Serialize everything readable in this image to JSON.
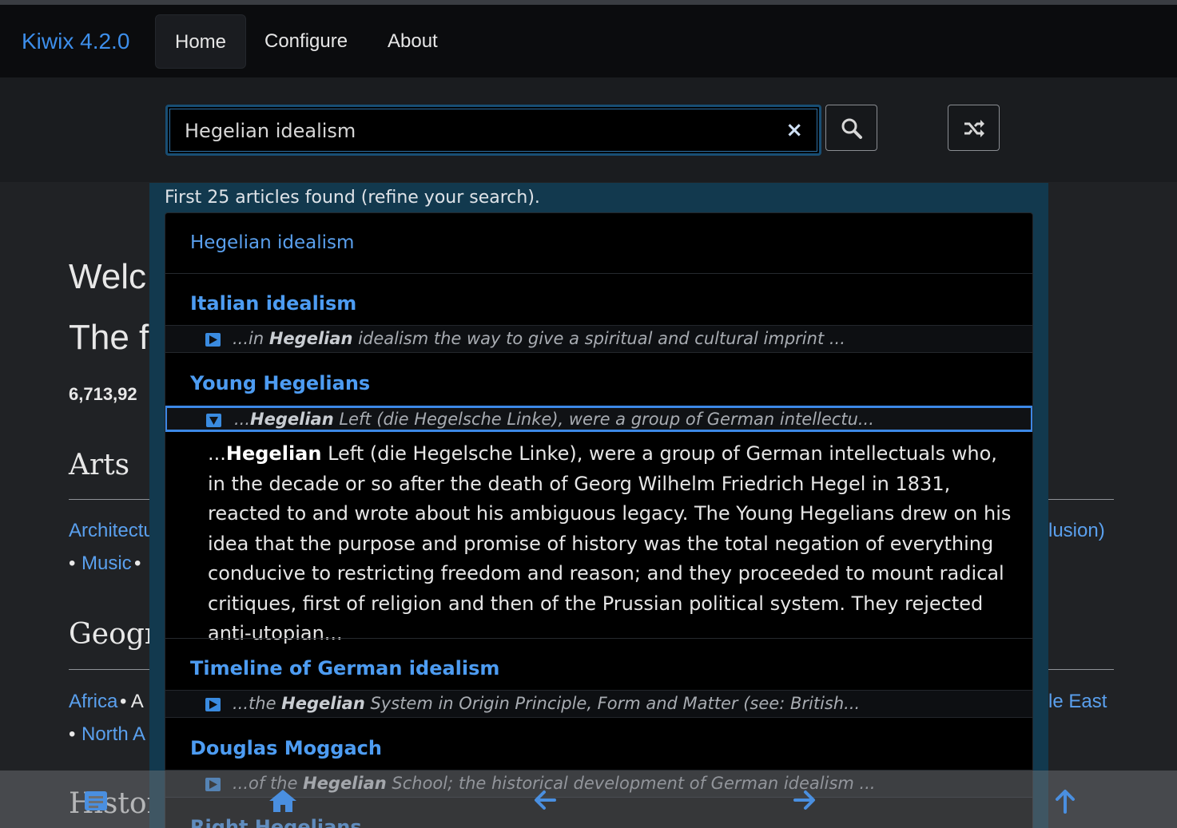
{
  "navbar": {
    "brand": "Kiwix 4.2.0",
    "items": [
      {
        "label": "Home",
        "active": true
      },
      {
        "label": "Configure",
        "active": false
      },
      {
        "label": "About",
        "active": false
      }
    ]
  },
  "search": {
    "value": "Hegelian idealism",
    "clear_label": "×"
  },
  "background_page": {
    "welcome_partial": "Welc",
    "subtitle_partial": "The f",
    "article_count_partial": "6,713,92",
    "sections": [
      {
        "heading": "Arts",
        "links_row1_left": "Architectu",
        "links_row1_right": "lusion)",
        "row2_prefix": "• ",
        "row2_link": "Music",
        "row2_suffix": " •"
      },
      {
        "heading": "Geogr",
        "links_row1_left": "Africa",
        "links_row1_mid": " • A",
        "links_row1_right": "le East",
        "row2_prefix": "• ",
        "row2_link": "North A"
      },
      {
        "heading": "Histor"
      }
    ]
  },
  "results": {
    "status": "First 25 articles found (refine your search).",
    "top_link": "Hegelian idealism",
    "items": [
      {
        "title": "Italian idealism",
        "snippet_pre": "...in ",
        "snippet_bold": "Hegelian",
        "snippet_post": " idealism the way to give a spiritual and cultural imprint ..."
      },
      {
        "title": "Young Hegelians",
        "snippet_pre": "...",
        "snippet_bold": "Hegelian",
        "snippet_post": " Left (die Hegelsche Linke), were a group of German intellectu...",
        "expanded_pre": "...",
        "expanded_bold": "Hegelian",
        "expanded_post": " Left (die Hegelsche Linke), were a group of German intellectuals who, in the decade or so after the death of Georg Wilhelm Friedrich Hegel in 1831, reacted to and wrote about his ambiguous legacy. The Young Hegelians drew on his idea that the purpose and promise of history was the total negation of everything conducive to restricting freedom and reason; and they proceeded to mount radical critiques, first of religion and then of the Prussian political system. They rejected anti-utopian..."
      },
      {
        "title": "Timeline of German idealism",
        "snippet_pre": "...the ",
        "snippet_bold": "Hegelian",
        "snippet_post": " System in Origin Principle, Form and Matter (see: British..."
      },
      {
        "title": "Douglas Moggach",
        "snippet_pre": "...of the ",
        "snippet_bold": "Hegelian",
        "snippet_post": " School; the historical development of German idealism ..."
      },
      {
        "title": "Right Hegelians"
      }
    ]
  },
  "bottombar": {
    "icons": [
      "table-of-contents-icon",
      "home-icon",
      "back-arrow-icon",
      "forward-arrow-icon",
      "scroll-up-icon"
    ]
  },
  "colors": {
    "brand": "#3d8eea",
    "link": "#4d9cf2",
    "overlay": "#12394e",
    "selected_border": "#3c88e6"
  }
}
